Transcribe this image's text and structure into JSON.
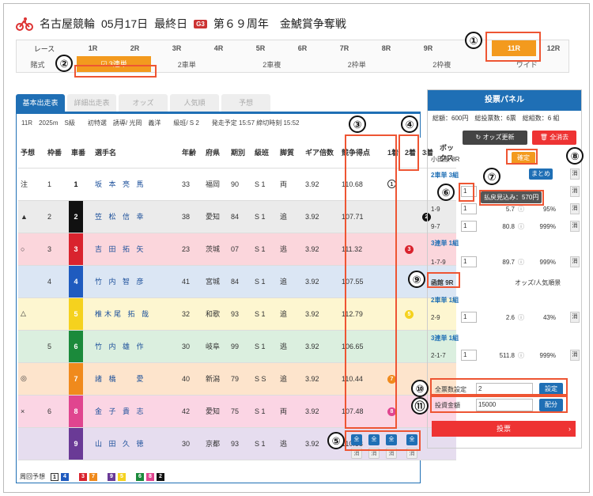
{
  "header": {
    "venue": "名古屋競輪",
    "date": "05月17日",
    "day": "最終日",
    "grade": "G3",
    "title": "第６９周年　金鯱賞争奪戦"
  },
  "race_bar": {
    "label": "レース",
    "races": [
      "1R",
      "2R",
      "3R",
      "4R",
      "5R",
      "6R",
      "7R",
      "8R",
      "9R"
    ],
    "active": "11R",
    "last": "12R"
  },
  "bet_types": {
    "label": "賭式",
    "items": [
      "3連単",
      "3連複",
      "2車単",
      "2車複",
      "2枠単",
      "2枠複",
      "ワイド"
    ],
    "active": "3連単"
  },
  "tabs": [
    "基本出走表",
    "詳細出走表",
    "オッズ",
    "人気順",
    "予想"
  ],
  "race_info": "11R　2025m　S級　　初特選　誘導/ 光岡　義洋　　級班/ S 2　　発走予定 15:57 締切時刻 15:52",
  "columns": [
    "予想",
    "枠番",
    "車番",
    "選手名",
    "年齢",
    "府県",
    "期別",
    "級班",
    "脚質",
    "ギア倍数",
    "競争得点",
    "1着",
    "2着",
    "3着",
    "ボックス"
  ],
  "riders": [
    {
      "pred": "注",
      "waku": "1",
      "car": "1",
      "name": "坂 本 亮 馬",
      "age": "33",
      "pref": "福岡",
      "term": "90",
      "cls": "S 1",
      "style": "両",
      "gear": "3.92",
      "score": "110.68",
      "c": "#ffffff",
      "fg": "#111",
      "m1": "1",
      "m2": "",
      "m3": ""
    },
    {
      "pred": "▲",
      "waku": "2",
      "car": "2",
      "name": "笠 松 信 幸",
      "age": "38",
      "pref": "愛知",
      "term": "84",
      "cls": "S 1",
      "style": "追",
      "gear": "3.92",
      "score": "107.71",
      "c": "#111111",
      "fg": "#fff",
      "m1": "",
      "m2": "",
      "m3": "2"
    },
    {
      "pred": "○",
      "waku": "3",
      "car": "3",
      "name": "吉 田 拓 矢",
      "age": "23",
      "pref": "茨城",
      "term": "07",
      "cls": "S 1",
      "style": "逃",
      "gear": "3.92",
      "score": "111.32",
      "c": "#d9232e",
      "fg": "#fff",
      "m1": "",
      "m2": "3",
      "m3": ""
    },
    {
      "pred": "",
      "waku": "4",
      "car": "4",
      "name": "竹 内 智 彦",
      "age": "41",
      "pref": "宮城",
      "term": "84",
      "cls": "S 1",
      "style": "追",
      "gear": "3.92",
      "score": "107.55",
      "c": "#1f5bbf",
      "fg": "#fff",
      "m1": "",
      "m2": "",
      "m3": ""
    },
    {
      "pred": "△",
      "waku": "",
      "car": "5",
      "name": "椎木尾 拓 哉",
      "age": "32",
      "pref": "和歌",
      "term": "93",
      "cls": "S 1",
      "style": "追",
      "gear": "3.92",
      "score": "112.79",
      "c": "#f5d21e",
      "fg": "#fff",
      "m1": "",
      "m2": "5",
      "m3": ""
    },
    {
      "pred": "",
      "waku": "5",
      "car": "6",
      "name": "竹 内 雄 作",
      "age": "30",
      "pref": "岐阜",
      "term": "99",
      "cls": "S 1",
      "style": "逃",
      "gear": "3.92",
      "score": "106.65",
      "c": "#1b8a3b",
      "fg": "#fff",
      "m1": "",
      "m2": "",
      "m3": ""
    },
    {
      "pred": "◎",
      "waku": "",
      "car": "7",
      "name": "諸 橋 　 愛",
      "age": "40",
      "pref": "新潟",
      "term": "79",
      "cls": "S S",
      "style": "追",
      "gear": "3.92",
      "score": "110.44",
      "c": "#f08a1c",
      "fg": "#fff",
      "m1": "7",
      "m2": "",
      "m3": ""
    },
    {
      "pred": "×",
      "waku": "6",
      "car": "8",
      "name": "金 子 貴 志",
      "age": "42",
      "pref": "愛知",
      "term": "75",
      "cls": "S 1",
      "style": "両",
      "gear": "3.92",
      "score": "107.48",
      "c": "#e0458f",
      "fg": "#fff",
      "m1": "8",
      "m2": "",
      "m3": ""
    },
    {
      "pred": "",
      "waku": "",
      "car": "9",
      "name": "山 田 久 徳",
      "age": "30",
      "pref": "京都",
      "term": "93",
      "cls": "S 1",
      "style": "逃",
      "gear": "3.92",
      "score": "110.58",
      "c": "#6a3a96",
      "fg": "#fff",
      "m1": "",
      "m2": "",
      "m3": ""
    }
  ],
  "ctrl": {
    "all": "全",
    "clear": "消"
  },
  "legend": {
    "label": "周回予想",
    "cars": [
      "1",
      "4",
      "3",
      "7",
      "9",
      "5",
      "6",
      "8",
      "2"
    ]
  },
  "bet_panel": {
    "title": "投票パネル",
    "summary": "総額：600円　総投票数：6票　総組数：6 組",
    "odds_update": "オッズ更新",
    "clear_all": "全消去",
    "race1": "小田原 8R",
    "confirm": "確定",
    "sec1": "2車単 3組",
    "matome": "まとめる",
    "keshi": "消",
    "rows1": [
      {
        "comb": "",
        "qty": "1",
        "odds": "",
        "pct": ""
      },
      {
        "comb": "1-9",
        "qty": "1",
        "odds": "5.7",
        "pct": "95%"
      },
      {
        "comb": "9-7",
        "qty": "1",
        "odds": "80.8",
        "pct": "999%"
      }
    ],
    "tooltip": "払戻見込み：570円",
    "sec2": "3連単 1組",
    "rows2": [
      {
        "comb": "1-7-9",
        "qty": "1",
        "odds": "89.7",
        "pct": "999%"
      }
    ],
    "race2": "函館 9R",
    "race2_right": "オッズ/人気順景",
    "sec3": "2車単 1組",
    "rows3": [
      {
        "comb": "2-9",
        "qty": "1",
        "odds": "2.6",
        "pct": "43%"
      }
    ],
    "sec4": "3連単 1組",
    "rows4": [
      {
        "comb": "2-1-7",
        "qty": "1",
        "odds": "511.8",
        "pct": "999%"
      }
    ],
    "set_label": "全票数設定",
    "set_val": "2",
    "set_btn": "設定",
    "amt_label": "投資金額",
    "amt_val": "15000",
    "amt_btn": "配分",
    "vote": "投票"
  },
  "annotations": [
    "①",
    "②",
    "③",
    "④",
    "⑤",
    "⑥",
    "⑦",
    "⑧",
    "⑨",
    "⑩",
    "⑪"
  ]
}
